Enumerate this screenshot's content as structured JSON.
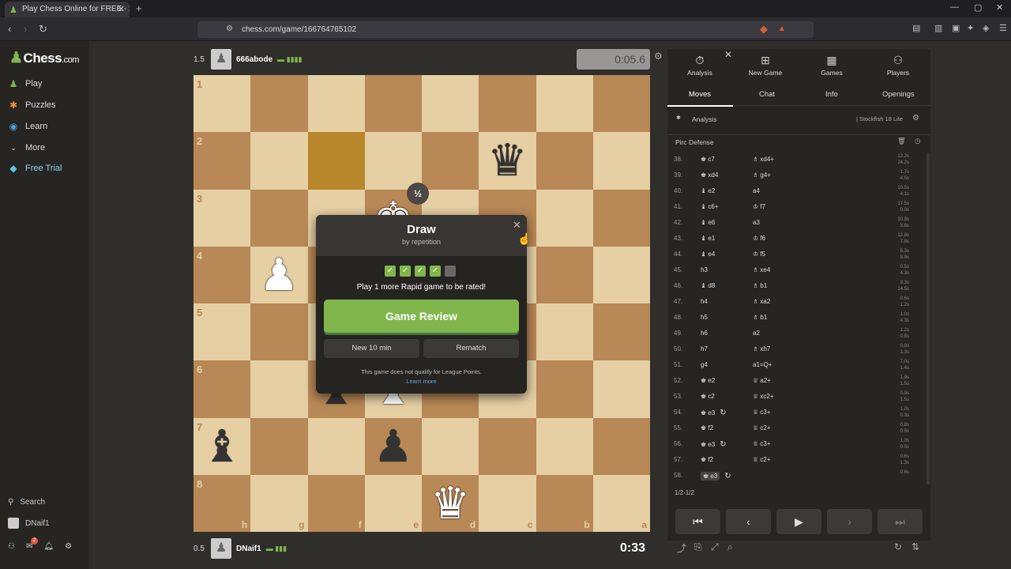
{
  "browser": {
    "tab_title": "Play Chess Online for FREE - 2 Pl",
    "url": "chess.com/game/166764765102"
  },
  "sidebar": {
    "logo": "Chess",
    "logo_suffix": ".com",
    "items": [
      {
        "label": "Play",
        "icon": "play-icon"
      },
      {
        "label": "Puzzles",
        "icon": "puzzle-icon"
      },
      {
        "label": "Learn",
        "icon": "learn-icon"
      },
      {
        "label": "More",
        "icon": "chevron-down-icon"
      },
      {
        "label": "Free Trial",
        "icon": "diamond-icon"
      }
    ],
    "search": "Search",
    "user": "DNaif1",
    "notification_count": "2"
  },
  "top_player": {
    "score": "1.5",
    "name": "666abode",
    "clock": "0:05.6"
  },
  "bottom_player": {
    "score": "0.5",
    "name": "DNaif1",
    "clock": "0:33"
  },
  "board": {
    "ranks": [
      "1",
      "2",
      "3",
      "4",
      "5",
      "6",
      "7",
      "8"
    ],
    "files": [
      "h",
      "g",
      "f",
      "e",
      "d",
      "c",
      "b",
      "a"
    ],
    "highlight": [
      [
        1,
        2
      ]
    ],
    "pieces": [
      {
        "r": 1,
        "c": 5,
        "p": "♛",
        "color": "b"
      },
      {
        "r": 2,
        "c": 3,
        "p": "♚",
        "color": "w"
      },
      {
        "r": 3,
        "c": 1,
        "p": "♟",
        "color": "w"
      },
      {
        "r": 5,
        "c": 2,
        "p": "♝",
        "color": "b"
      },
      {
        "r": 5,
        "c": 3,
        "p": "♝",
        "color": "w"
      },
      {
        "r": 6,
        "c": 0,
        "p": "♝",
        "color": "b"
      },
      {
        "r": 6,
        "c": 3,
        "p": "♟",
        "color": "b"
      },
      {
        "r": 7,
        "c": 4,
        "p": "♛",
        "color": "w"
      }
    ]
  },
  "modal": {
    "badge": "½",
    "title": "Draw",
    "subtitle": "by repetition",
    "checks_done": 4,
    "checks_total": 5,
    "rated_msg": "Play 1 more Rapid game to be rated!",
    "review_label": "Game Review",
    "new_label": "New 10 min",
    "rematch_label": "Rematch",
    "league_msg": "This game does not qualify for League Points.",
    "learn_more": "Learn more"
  },
  "panel": {
    "nav": [
      {
        "label": "Analysis",
        "icon": "stopwatch-icon"
      },
      {
        "label": "New Game",
        "icon": "plus-icon"
      },
      {
        "label": "Games",
        "icon": "board-icon"
      },
      {
        "label": "Players",
        "icon": "players-icon"
      }
    ],
    "tabs": [
      "Moves",
      "Chat",
      "Info",
      "Openings"
    ],
    "analysis_label": "Analysis",
    "engine": "Stockfish 18 Lite",
    "opening": "Pirc Defense",
    "result": "1/2-1/2"
  },
  "moves": [
    {
      "n": "38.",
      "w": "♚ c7",
      "b": "♗ xd4+",
      "t": [
        "12.2s",
        "24.2s"
      ]
    },
    {
      "n": "39.",
      "w": "♚ xd4",
      "b": "♗ g4+",
      "t": [
        "1.7s",
        "4.5s"
      ]
    },
    {
      "n": "40.",
      "w": "♝ e2",
      "b": "a4",
      "t": [
        "10.5s",
        "4.1s"
      ]
    },
    {
      "n": "41.",
      "w": "♝ c6+",
      "b": "♔ f7",
      "t": [
        "17.5s",
        "0.0s"
      ]
    },
    {
      "n": "42.",
      "w": "♝ e6",
      "b": "a3",
      "t": [
        "10.8s",
        "3.6s"
      ]
    },
    {
      "n": "43.",
      "w": "♝ e1",
      "b": "♔ f6",
      "t": [
        "12.8s",
        "7.8s"
      ]
    },
    {
      "n": "44.",
      "w": "♝ e4",
      "b": "♔ f5",
      "t": [
        "6.3s",
        "9.9s"
      ]
    },
    {
      "n": "45.",
      "w": "h3",
      "b": "♗ xe4",
      "t": [
        "0.5s",
        "4.3s"
      ]
    },
    {
      "n": "46.",
      "w": "♝ d8",
      "b": "♗ b1",
      "t": [
        "9.3s",
        "14.5s"
      ]
    },
    {
      "n": "47.",
      "w": "h4",
      "b": "♗ xa2",
      "t": [
        "0.6s",
        "1.2s"
      ]
    },
    {
      "n": "48.",
      "w": "h5",
      "b": "♗ b1",
      "t": [
        "1.0s",
        "4.3s"
      ]
    },
    {
      "n": "49.",
      "w": "h6",
      "b": "a2",
      "t": [
        "1.2s",
        "0.8s"
      ]
    },
    {
      "n": "50.",
      "w": "h7",
      "b": "♗ xh7",
      "t": [
        "0.9s",
        "1.3s"
      ]
    },
    {
      "n": "51.",
      "w": "g4",
      "b": "a1=Q+",
      "t": [
        "7.0s",
        "1.4s"
      ]
    },
    {
      "n": "52.",
      "w": "♚ e2",
      "b": "♕ a2+",
      "t": [
        "1.9s",
        "1.5s"
      ]
    },
    {
      "n": "53.",
      "w": "♚ c2",
      "b": "♕ xc2+",
      "t": [
        "0.9s",
        "1.5s"
      ]
    },
    {
      "n": "54.",
      "w": "♚ e3",
      "b": "♕ c3+",
      "t": [
        "1.0s",
        "0.3s"
      ]
    },
    {
      "n": "55.",
      "w": "♚ f2",
      "b": "♕ c2+",
      "t": [
        "0.8s",
        "0.5s"
      ]
    },
    {
      "n": "56.",
      "w": "♚ e3",
      "b": "♕ c3+",
      "t": [
        "1.0s",
        "0.5s"
      ]
    },
    {
      "n": "57.",
      "w": "♚ f2",
      "b": "♕ c2+",
      "t": [
        "0.6s",
        "1.3s"
      ]
    },
    {
      "n": "58.",
      "w": "♚ e3",
      "b": "",
      "t": [
        "0.6s",
        ""
      ]
    }
  ],
  "colors": {
    "accent": "#81b64c",
    "light_square": "#e5cfa3",
    "dark_square": "#b88856"
  }
}
